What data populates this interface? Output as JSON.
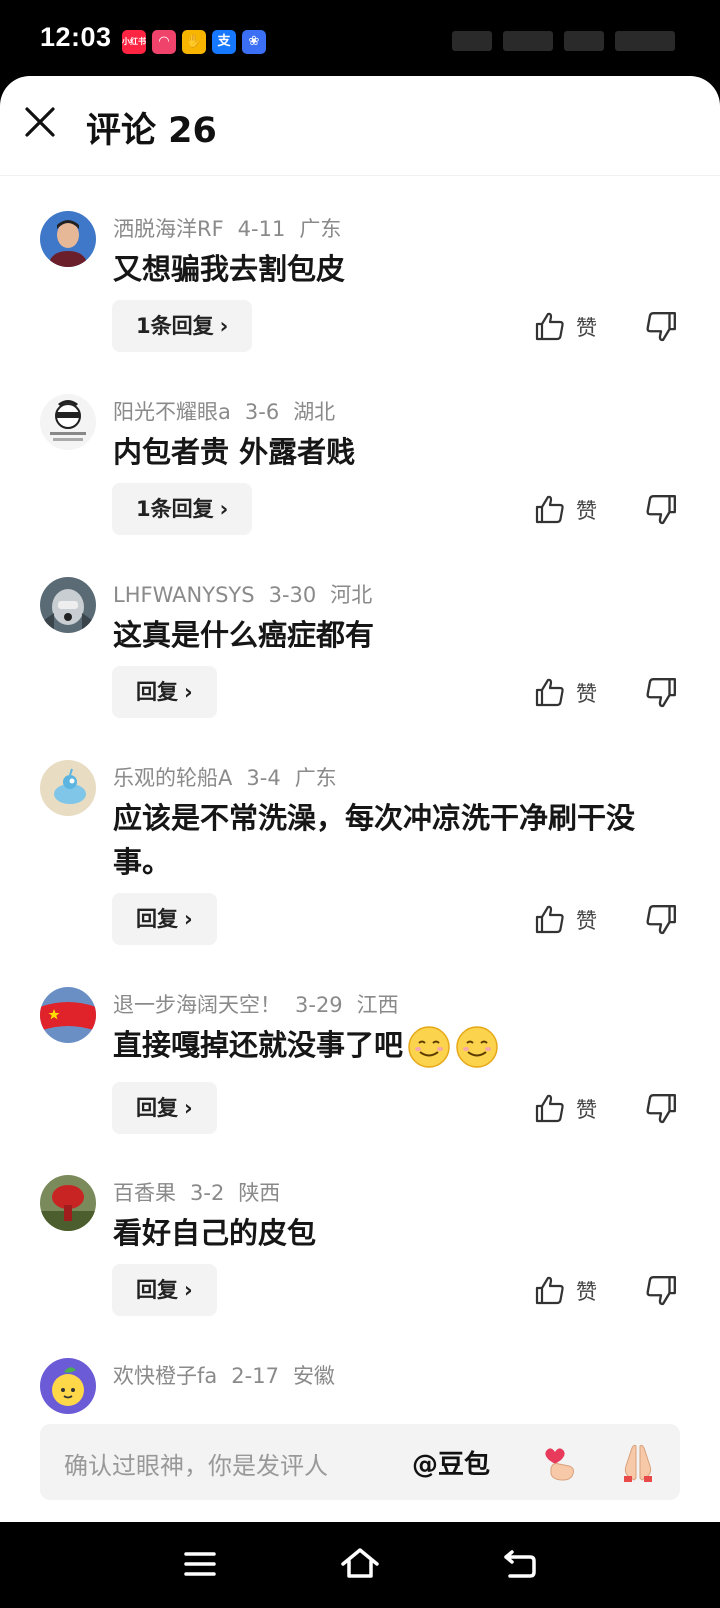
{
  "status_bar": {
    "time": "12:03",
    "apps": [
      {
        "name": "xiaohongshu-app-icon",
        "label": "小红书",
        "color": "#ff2442"
      },
      {
        "name": "app-icon-pink",
        "label": "◠",
        "color": "#f0436b"
      },
      {
        "name": "app-icon-yellow",
        "label": "✋",
        "color": "#f7b500"
      },
      {
        "name": "alipay-app-icon",
        "label": "支",
        "color": "#1677ff"
      },
      {
        "name": "baidu-app-icon",
        "label": "❀",
        "color": "#3b6ff5"
      }
    ]
  },
  "header": {
    "title": "评论 26"
  },
  "comments": [
    {
      "user": "洒脱海洋RF",
      "date": "4-11",
      "region": "广东",
      "text": "又想骗我去割包皮",
      "reply_label": "1条回复",
      "like_label": "赞"
    },
    {
      "user": "阳光不耀眼a",
      "date": "3-6",
      "region": "湖北",
      "text": "内包者贵 外露者贱",
      "reply_label": "1条回复",
      "like_label": "赞"
    },
    {
      "user": "LHFWANYSYS",
      "date": "3-30",
      "region": "河北",
      "text": "这真是什么癌症都有",
      "reply_label": "回复",
      "like_label": "赞"
    },
    {
      "user": "乐观的轮船A",
      "date": "3-4",
      "region": "广东",
      "text": "应该是不常洗澡，每次冲凉洗干净刷干没事。",
      "reply_label": "回复",
      "like_label": "赞"
    },
    {
      "user": "退一步海阔天空！",
      "date": "3-29",
      "region": "江西",
      "text": "直接嘎掉还就没事了吧",
      "reply_label": "回复",
      "like_label": "赞"
    },
    {
      "user": "百香果",
      "date": "3-2",
      "region": "陕西",
      "text": "看好自己的皮包",
      "reply_label": "回复",
      "like_label": "赞"
    },
    {
      "user": "欢快橙子fa",
      "date": "2-17",
      "region": "安徽"
    }
  ],
  "input": {
    "placeholder": "确认过眼神，你是发评人",
    "mention": "@豆包"
  },
  "colors": {
    "sheet_bg": "#ffffff",
    "meta_text": "#8a8a8a",
    "reply_bg": "#f3f3f3"
  },
  "icons": [
    "close-icon",
    "thumbs-up-icon",
    "thumbs-down-icon",
    "chevron-right-icon",
    "finger-heart-emoji",
    "pray-hands-emoji",
    "menu-icon",
    "home-icon",
    "back-icon"
  ]
}
